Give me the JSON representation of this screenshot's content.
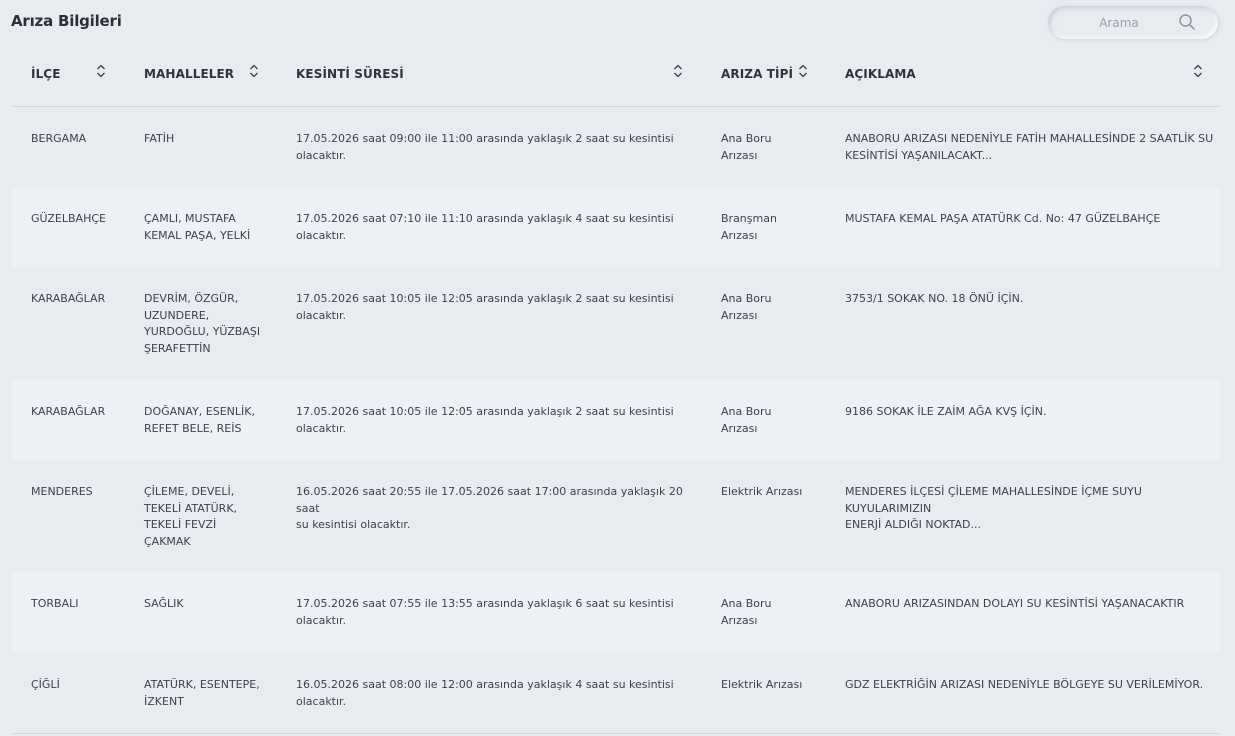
{
  "page_title": "Arıza Bilgileri",
  "search": {
    "placeholder": "Arama",
    "value": ""
  },
  "icons": {
    "search": "search-icon",
    "sort": "sort-arrows-icon"
  },
  "table": {
    "headers": [
      "İLÇE",
      "MAHALLELER",
      "KESİNTİ SÜRESİ",
      "ARIZA TİPİ",
      "AÇIKLAMA"
    ],
    "rows": [
      {
        "ilce": "BERGAMA",
        "mahalleler": [
          "FATİH"
        ],
        "sure": [
          "17.05.2026 saat 09:00 ile 11:00 arasında yaklaşık 2 saat su kesintisi",
          "olacaktır."
        ],
        "tip": [
          "Ana Boru",
          "Arızası"
        ],
        "aciklama": [
          "ANABORU ARIZASI NEDENİYLE FATİH MAHALLESİNDE 2 SAATLİK SU",
          "KESİNTİSİ YAŞANILACAKT..."
        ]
      },
      {
        "ilce": "GÜZELBAHÇE",
        "mahalleler": [
          "ÇAMLI, MUSTAFA",
          "KEMAL PAŞA, YELKİ"
        ],
        "sure": [
          "17.05.2026 saat 07:10 ile 11:10 arasında yaklaşık 4 saat su kesintisi",
          "olacaktır."
        ],
        "tip": [
          "Branşman",
          "Arızası"
        ],
        "aciklama": [
          "MUSTAFA KEMAL PAŞA ATATÜRK Cd. No: 47 GÜZELBAHÇE"
        ]
      },
      {
        "ilce": "KARABAĞLAR",
        "mahalleler": [
          "DEVRİM, ÖZGÜR,",
          "UZUNDERE,",
          "YURDOĞLU, YÜZBAŞI",
          "ŞERAFETTİN"
        ],
        "sure": [
          "17.05.2026 saat 10:05 ile 12:05 arasında yaklaşık 2 saat su kesintisi",
          "olacaktır."
        ],
        "tip": [
          "Ana Boru",
          "Arızası"
        ],
        "aciklama": [
          "3753/1 SOKAK NO. 18 ÖNÜ İÇİN."
        ]
      },
      {
        "ilce": "KARABAĞLAR",
        "mahalleler": [
          "DOĞANAY, ESENLİK,",
          "REFET BELE, REİS"
        ],
        "sure": [
          "17.05.2026 saat 10:05 ile 12:05 arasında yaklaşık 2 saat su kesintisi",
          "olacaktır."
        ],
        "tip": [
          "Ana Boru",
          "Arızası"
        ],
        "aciklama": [
          "9186 SOKAK İLE ZAİM AĞA KVŞ İÇİN."
        ]
      },
      {
        "ilce": "MENDERES",
        "mahalleler": [
          "ÇİLEME, DEVELİ,",
          "TEKELİ ATATÜRK,",
          "TEKELİ FEVZİ",
          "ÇAKMAK"
        ],
        "sure": [
          "16.05.2026 saat 20:55 ile 17.05.2026 saat 17:00 arasında yaklaşık 20 saat",
          "su kesintisi olacaktır."
        ],
        "tip": [
          "Elektrik Arızası"
        ],
        "aciklama": [
          "MENDERES İLÇESİ ÇİLEME MAHALLESİNDE İÇME SUYU KUYULARIMIZIN",
          "ENERJİ ALDIĞI NOKTAD..."
        ]
      },
      {
        "ilce": "TORBALI",
        "mahalleler": [
          "SAĞLIK"
        ],
        "sure": [
          "17.05.2026 saat 07:55 ile 13:55 arasında yaklaşık 6 saat su kesintisi",
          "olacaktır."
        ],
        "tip": [
          "Ana Boru",
          "Arızası"
        ],
        "aciklama": [
          "ANABORU ARIZASINDAN DOLAYI SU KESİNTİSİ YAŞANACAKTIR"
        ]
      },
      {
        "ilce": "ÇİĞLİ",
        "mahalleler": [
          "ATATÜRK, ESENTEPE,",
          "İZKENT"
        ],
        "sure": [
          "16.05.2026 saat 08:00 ile 12:00 arasında yaklaşık 4 saat su kesintisi",
          "olacaktır."
        ],
        "tip": [
          "Elektrik Arızası"
        ],
        "aciklama": [
          "GDZ ELEKTRİĞİN ARIZASI NEDENİYLE BÖLGEYE SU VERİLEMİYOR."
        ]
      }
    ]
  }
}
